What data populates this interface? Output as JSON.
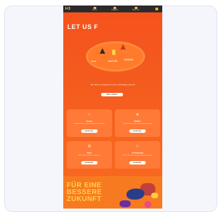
{
  "navbar": {
    "logo": "I<3",
    "items": [
      {
        "label": "Home"
      },
      {
        "label": "Projekte"
      },
      {
        "label": "Über uns"
      }
    ]
  },
  "hero": {
    "headline": "LET US F",
    "badges": [
      "BLUE",
      "NATUR",
      "TOKEN"
    ],
    "lead": "Wir fördern Projekte für eine nachhaltige Zukunft",
    "button": "Mehr erfahren"
  },
  "tiles": [
    {
      "title": "Ozean",
      "text": "Unterstütze den Schutz der Meere und Küsten",
      "button": "Entdecken",
      "icon": "wave-icon"
    },
    {
      "title": "Wälder",
      "text": "Pflanze Bäume und schütze Lebensräume",
      "button": "Entdecken",
      "icon": "tree-icon"
    },
    {
      "title": "Tiere",
      "text": "Hilf bedrohten Arten zu überleben",
      "button": "Entdecken",
      "icon": "paw-icon"
    },
    {
      "title": "Community",
      "text": "Werde Teil einer wachsenden Gemeinschaft",
      "button": "Entdecken",
      "icon": "people-icon"
    }
  ],
  "banner": {
    "line1": "FÜR EINE",
    "line2": "BESSERE",
    "line3": "ZUKUNFT"
  },
  "colors": {
    "primary": "#f6511d",
    "accent": "#ffd24a",
    "tile": "#ff7a36"
  }
}
